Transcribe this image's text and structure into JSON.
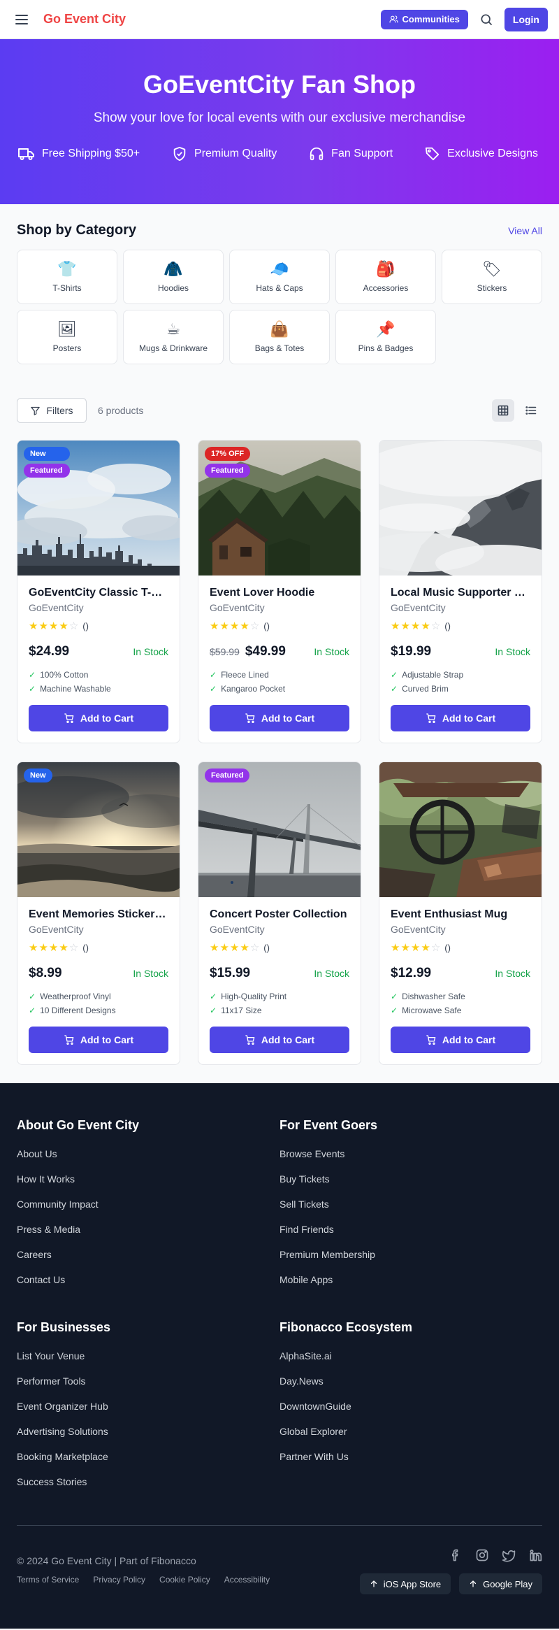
{
  "header": {
    "logo": "Go Event City",
    "communities_label": "Communities",
    "login_label": "Login"
  },
  "hero": {
    "title": "GoEventCity Fan Shop",
    "subtitle": "Show your love for local events with our exclusive merchandise",
    "features": [
      {
        "icon": "truck-icon",
        "label": "Free Shipping $50+"
      },
      {
        "icon": "shield-check-icon",
        "label": "Premium Quality"
      },
      {
        "icon": "headphones-icon",
        "label": "Fan Support"
      },
      {
        "icon": "tag-icon",
        "label": "Exclusive Designs"
      }
    ]
  },
  "categories": {
    "title": "Shop by Category",
    "view_all": "View All",
    "items": [
      {
        "icon": "👕",
        "label": "T-Shirts"
      },
      {
        "icon": "🧥",
        "label": "Hoodies"
      },
      {
        "icon": "🧢",
        "label": "Hats & Caps"
      },
      {
        "icon": "🎒",
        "label": "Accessories"
      },
      {
        "icon": "🏷",
        "label": "Stickers"
      },
      {
        "icon": "🖼",
        "label": "Posters"
      },
      {
        "icon": "☕",
        "label": "Mugs & Drinkware"
      },
      {
        "icon": "👜",
        "label": "Bags & Totes"
      },
      {
        "icon": "📌",
        "label": "Pins & Badges"
      }
    ]
  },
  "toolbar": {
    "filters_label": "Filters",
    "count": "6 products"
  },
  "products": [
    {
      "name": "GoEventCity Classic T-Shirt",
      "brand": "GoEventCity",
      "rating": 4,
      "rating_count": "()",
      "price": "$24.99",
      "old_price": "",
      "stock": "In Stock",
      "features": [
        "100% Cotton",
        "Machine Washable"
      ],
      "badges": [
        "New",
        "Featured"
      ],
      "cta": "Add to Cart",
      "image": "city-skyline-photo"
    },
    {
      "name": "Event Lover Hoodie",
      "brand": "GoEventCity",
      "rating": 4,
      "rating_count": "()",
      "price": "$49.99",
      "old_price": "$59.99",
      "stock": "In Stock",
      "features": [
        "Fleece Lined",
        "Kangaroo Pocket"
      ],
      "badges": [
        "17% OFF",
        "Featured"
      ],
      "cta": "Add to Cart",
      "image": "forest-cabin-photo"
    },
    {
      "name": "Local Music Supporter Cap",
      "brand": "GoEventCity",
      "rating": 4,
      "rating_count": "()",
      "price": "$19.99",
      "old_price": "",
      "stock": "In Stock",
      "features": [
        "Adjustable Strap",
        "Curved Brim"
      ],
      "badges": [],
      "cta": "Add to Cart",
      "image": "misty-mountain-photo"
    },
    {
      "name": "Event Memories Sticker Pack",
      "brand": "GoEventCity",
      "rating": 4,
      "rating_count": "()",
      "price": "$8.99",
      "old_price": "",
      "stock": "In Stock",
      "features": [
        "Weatherproof Vinyl",
        "10 Different Designs"
      ],
      "badges": [
        "New"
      ],
      "cta": "Add to Cart",
      "image": "ocean-sunset-photo"
    },
    {
      "name": "Concert Poster Collection",
      "brand": "GoEventCity",
      "rating": 4,
      "rating_count": "()",
      "price": "$15.99",
      "old_price": "",
      "stock": "In Stock",
      "features": [
        "High-Quality Print",
        "11x17 Size"
      ],
      "badges": [
        "Featured"
      ],
      "cta": "Add to Cart",
      "image": "foggy-bridge-photo"
    },
    {
      "name": "Event Enthusiast Mug",
      "brand": "GoEventCity",
      "rating": 4,
      "rating_count": "()",
      "price": "$12.99",
      "old_price": "",
      "stock": "In Stock",
      "features": [
        "Dishwasher Safe",
        "Microwave Safe"
      ],
      "badges": [],
      "cta": "Add to Cart",
      "image": "abandoned-truck-photo"
    }
  ],
  "footer": {
    "columns": [
      {
        "title": "About Go Event City",
        "links": [
          "About Us",
          "How It Works",
          "Community Impact",
          "Press & Media",
          "Careers",
          "Contact Us"
        ]
      },
      {
        "title": "For Event Goers",
        "links": [
          "Browse Events",
          "Buy Tickets",
          "Sell Tickets",
          "Find Friends",
          "Premium Membership",
          "Mobile Apps"
        ]
      },
      {
        "title": "For Businesses",
        "links": [
          "List Your Venue",
          "Performer Tools",
          "Event Organizer Hub",
          "Advertising Solutions",
          "Booking Marketplace",
          "Success Stories"
        ]
      },
      {
        "title": "Fibonacco Ecosystem",
        "links": [
          "AlphaSite.ai",
          "Day.News",
          "DowntownGuide",
          "Global Explorer",
          "Partner With Us"
        ]
      }
    ],
    "copyright": "© 2024 Go Event City | Part of Fibonacco",
    "legal": [
      "Terms of Service",
      "Privacy Policy",
      "Cookie Policy",
      "Accessibility"
    ],
    "socials": [
      "facebook-icon",
      "instagram-icon",
      "twitter-icon",
      "linkedin-icon"
    ],
    "apps": [
      "iOS App Store",
      "Google Play"
    ]
  },
  "colors": {
    "brand": "#ef4444",
    "primary": "#4f46e5",
    "in_stock": "#16a34a",
    "badge_new": "#2563eb",
    "badge_featured": "#9333ea",
    "badge_sale": "#dc2626",
    "footer_bg": "#111827"
  }
}
